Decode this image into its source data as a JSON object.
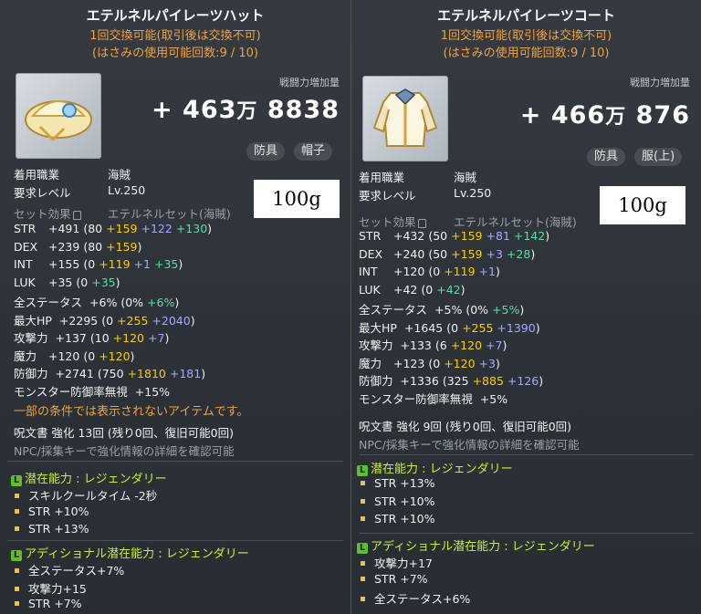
{
  "left": {
    "title": "エテルネルパイレーツハット",
    "exchange": "1回交換可能(取引後は交換不可)",
    "scissors": "(はさみの使用可能回数:9 / 10)",
    "cp_label": "戦闘力増加量",
    "cp_plus": "+",
    "cp_main": "463",
    "cp_unit": "万",
    "cp_rest": "8838",
    "tag1": "防具",
    "tag2": "帽子",
    "job_label": "着用職業",
    "job_value": "海賊",
    "level_label": "要求レベル",
    "level_value": "Lv.250",
    "note": "100g",
    "set_label": "セット効果",
    "set_name": "エテルネルセット(海賊)",
    "stats": [
      {
        "name": "STR",
        "total": "+491",
        "open": "(80",
        "yellow": "+159",
        "blue": "+122",
        "green": "+130",
        "close": ")"
      },
      {
        "name": "DEX",
        "total": "+239",
        "open": "(80",
        "yellow": "+159",
        "blue": "",
        "green": "",
        "close": ")"
      },
      {
        "name": "INT",
        "total": "+155",
        "open": "(0",
        "yellow": "+119",
        "blue": "+1",
        "green": "+35",
        "close": ")"
      },
      {
        "name": "LUK",
        "total": "+35",
        "open": "(0",
        "yellow": "",
        "blue": "",
        "green": "+35",
        "close": ")"
      },
      {
        "name": "全ステータス",
        "total": "+6%",
        "open": "(0%",
        "yellow": "",
        "blue": "",
        "green": "+6%",
        "close": ")"
      },
      {
        "name": "最大HP",
        "total": "+2295",
        "open": "(0",
        "yellow": "+255",
        "blue": "+2040",
        "green": "",
        "close": ")"
      },
      {
        "name": "攻撃力",
        "total": "+137",
        "open": "(10",
        "yellow": "+120",
        "blue": "+7",
        "green": "",
        "close": ")"
      },
      {
        "name": "魔力",
        "total": "+120",
        "open": "(0",
        "yellow": "+120",
        "blue": "",
        "green": "",
        "close": ")"
      },
      {
        "name": "防御力",
        "total": "+2741",
        "open": "(750",
        "yellow": "+1810",
        "blue": "+181",
        "green": "",
        "close": ")"
      },
      {
        "name": "モンスター防御率無視",
        "total": "+15%",
        "open": "",
        "yellow": "",
        "blue": "",
        "green": "",
        "close": ""
      }
    ],
    "condition": "一部の条件では表示されないアイテムです。",
    "scroll": "呪文書 強化 13回 (残り0回、復旧可能0回)",
    "npc": "NPC/採集キーで強化情報の詳細を確認可能",
    "potential_title": "潜在能力 : レジェンダリー",
    "potential": [
      "スキルクールタイム -2秒",
      "STR +10%",
      "STR +13%"
    ],
    "additional_title": "アディショナル潜在能力 : レジェンダリー",
    "additional": [
      "全ステータス+7%",
      "攻撃力+15",
      "STR +7%"
    ]
  },
  "right": {
    "title": "エテルネルパイレーツコート",
    "exchange": "1回交換可能(取引後は交換不可)",
    "scissors": "(はさみの使用可能回数:9 / 10)",
    "cp_label": "戦闘力増加量",
    "cp_plus": "+",
    "cp_main": "466",
    "cp_unit": "万",
    "cp_rest": "876",
    "tag1": "防具",
    "tag2": "服(上)",
    "job_label": "着用職業",
    "job_value": "海賊",
    "level_label": "要求レベル",
    "level_value": "Lv.250",
    "note": "100g",
    "set_label": "セット効果",
    "set_name": "エテルネルセット(海賊)",
    "stats": [
      {
        "name": "STR",
        "total": "+432",
        "open": "(50",
        "yellow": "+159",
        "blue": "+81",
        "green": "+142",
        "close": ")"
      },
      {
        "name": "DEX",
        "total": "+240",
        "open": "(50",
        "yellow": "+159",
        "blue": "+3",
        "green": "+28",
        "close": ")"
      },
      {
        "name": "INT",
        "total": "+120",
        "open": "(0",
        "yellow": "+119",
        "blue": "+1",
        "green": "",
        "close": ")"
      },
      {
        "name": "LUK",
        "total": "+42",
        "open": "(0",
        "yellow": "",
        "blue": "",
        "green": "+42",
        "close": ")"
      },
      {
        "name": "全ステータス",
        "total": "+5%",
        "open": "(0%",
        "yellow": "",
        "blue": "",
        "green": "+5%",
        "close": ")"
      },
      {
        "name": "最大HP",
        "total": "+1645",
        "open": "(0",
        "yellow": "+255",
        "blue": "+1390",
        "green": "",
        "close": ")"
      },
      {
        "name": "攻撃力",
        "total": "+133",
        "open": "(6",
        "yellow": "+120",
        "blue": "+7",
        "green": "",
        "close": ")"
      },
      {
        "name": "魔力",
        "total": "+123",
        "open": "(0",
        "yellow": "+120",
        "blue": "+3",
        "green": "",
        "close": ")"
      },
      {
        "name": "防御力",
        "total": "+1336",
        "open": "(325",
        "yellow": "+885",
        "blue": "+126",
        "green": "",
        "close": ")"
      },
      {
        "name": "モンスター防御率無視",
        "total": "+5%",
        "open": "",
        "yellow": "",
        "blue": "",
        "green": "",
        "close": ""
      }
    ],
    "scroll": "呪文書 強化 9回 (残り0回、復旧可能0回)",
    "npc": "NPC/採集キーで強化情報の詳細を確認可能",
    "potential_title": "潜在能力 : レジェンダリー",
    "potential": [
      "STR +13%",
      "STR +10%",
      "STR +10%"
    ],
    "additional_title": "アディショナル潜在能力 : レジェンダリー",
    "additional": [
      "攻撃力+17",
      "STR +7%",
      "全ステータス+6%"
    ]
  },
  "colors": {
    "orange": "#f2a23a",
    "yellow": "#ffcc00",
    "blue": "#a8a8ff",
    "green": "#55e0a0",
    "legendary": "#c9f02e"
  }
}
